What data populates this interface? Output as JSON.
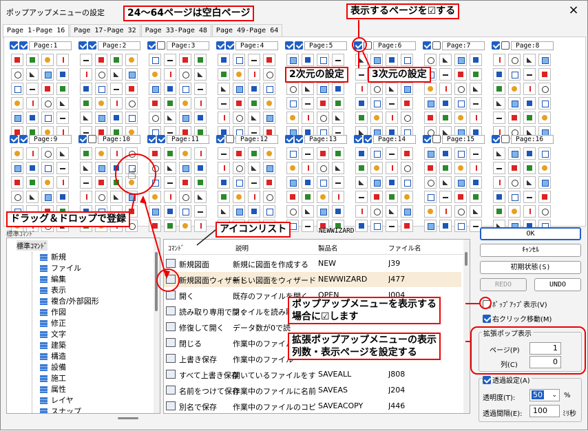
{
  "window": {
    "title": "ポップアップメニューの設定",
    "close_icon": "×"
  },
  "tabs": [
    "Page 1-Page 16",
    "Page 17-Page 32",
    "Page 33-Page 48",
    "Page 49-Page 64"
  ],
  "pages": [
    {
      "label": "Page:1",
      "checked": true
    },
    {
      "label": "Page:2",
      "checked": true
    },
    {
      "label": "Page:3",
      "checked": false
    },
    {
      "label": "Page:4",
      "checked": true
    },
    {
      "label": "Page:5",
      "checked": true
    },
    {
      "label": "Page:6",
      "checked": false
    },
    {
      "label": "Page:7",
      "checked": false
    },
    {
      "label": "Page:8",
      "checked": false
    },
    {
      "label": "Page:9",
      "checked": true
    },
    {
      "label": "Page:10",
      "checked": false
    },
    {
      "label": "Page:11",
      "checked": true
    },
    {
      "label": "Page:12",
      "checked": false
    },
    {
      "label": "Page:13",
      "checked": true
    },
    {
      "label": "Page:14",
      "checked": true
    },
    {
      "label": "Page:15",
      "checked": false
    },
    {
      "label": "Page:16",
      "checked": false
    }
  ],
  "callouts": {
    "blank_pages": "24～64ページは空白ページ",
    "check_pages": "表示するページを☑する",
    "two_d": "2次元の設定",
    "three_d": "3次元の設定",
    "drag_drop": "ドラッグ＆ドロップで登録",
    "icon_list": "アイコンリスト",
    "popup_show": "ポップアップメニューを表示する\n場合に☑します",
    "ext_popup": "拡張ポップアップメニューの表示\n列数・表示ページを設定する"
  },
  "tree": {
    "header": "標準ｺﾏﾝﾄﾞ",
    "root": "標準ｺﾏﾝﾄﾞ",
    "items": [
      "新規",
      "ファイル",
      "編集",
      "表示",
      "複合/外部図形",
      "作図",
      "修正",
      "文字",
      "建築",
      "構造",
      "設備",
      "施工",
      "属性",
      "レイヤ",
      "スナップ"
    ]
  },
  "list": {
    "current": "NEWWIZARD",
    "headers": {
      "command": "ｺﾏﾝﾄﾞ",
      "desc": "説明",
      "product": "製品名",
      "file": "ファイル名"
    },
    "rows": [
      {
        "cmd": "新規図面",
        "desc": "新規に図面を作成する",
        "product": "NEW",
        "file": "J39"
      },
      {
        "cmd": "新規図面ウィザード",
        "desc": "新しい図面をウィザード",
        "product": "NEWWIZARD",
        "file": "J477"
      },
      {
        "cmd": "開く",
        "desc": "既存のファイルを開く",
        "product": "OPEN",
        "file": "J004"
      },
      {
        "cmd": "読み取り専用で開く",
        "desc": "ファイルを読み取り",
        "product": "",
        "file": ""
      },
      {
        "cmd": "修復して開く",
        "desc": "データ数が0で読",
        "product": "",
        "file": ""
      },
      {
        "cmd": "閉じる",
        "desc": "作業中のファイルを",
        "product": "",
        "file": ""
      },
      {
        "cmd": "上書き保存",
        "desc": "作業中のファイル",
        "product": "",
        "file": ""
      },
      {
        "cmd": "すべて上書き保存",
        "desc": "開いているファイルをす",
        "product": "SAVEALL",
        "file": "J808"
      },
      {
        "cmd": "名前をつけて保存",
        "desc": "作業中のファイルに名前",
        "product": "SAVEAS",
        "file": "J204"
      },
      {
        "cmd": "別名で保存",
        "desc": "作業中のファイルのコピ",
        "product": "SAVEACOPY",
        "file": "J446"
      }
    ]
  },
  "buttons": {
    "ok": "OK",
    "cancel": "ｷｬﾝｾﾙ",
    "reset": "初期状態(S)",
    "redo": "REDO",
    "undo": "UNDO"
  },
  "options": {
    "popup_show": "ﾎﾟｯﾌﾟｱｯﾌﾟ表示(V)",
    "popup_show_checked": false,
    "right_click": "右クリック移動(M)",
    "right_click_checked": true
  },
  "ext_popup": {
    "title": "拡張ポップ表示",
    "page_label": "ページ(P)",
    "page_value": "1",
    "col_label": "列(C)",
    "col_value": "0"
  },
  "transparency": {
    "title": "透過設定(A)",
    "checked": true,
    "degree_label": "透明度(T):",
    "degree_value": "50",
    "degree_unit": "%",
    "interval_label": "透過間隔(E):",
    "interval_value": "100",
    "interval_unit": "ﾐﾘ秒"
  },
  "colors": {
    "accent": "#1f5fc4",
    "callout": "#e00000",
    "selected_row": "#f8ecd8"
  }
}
